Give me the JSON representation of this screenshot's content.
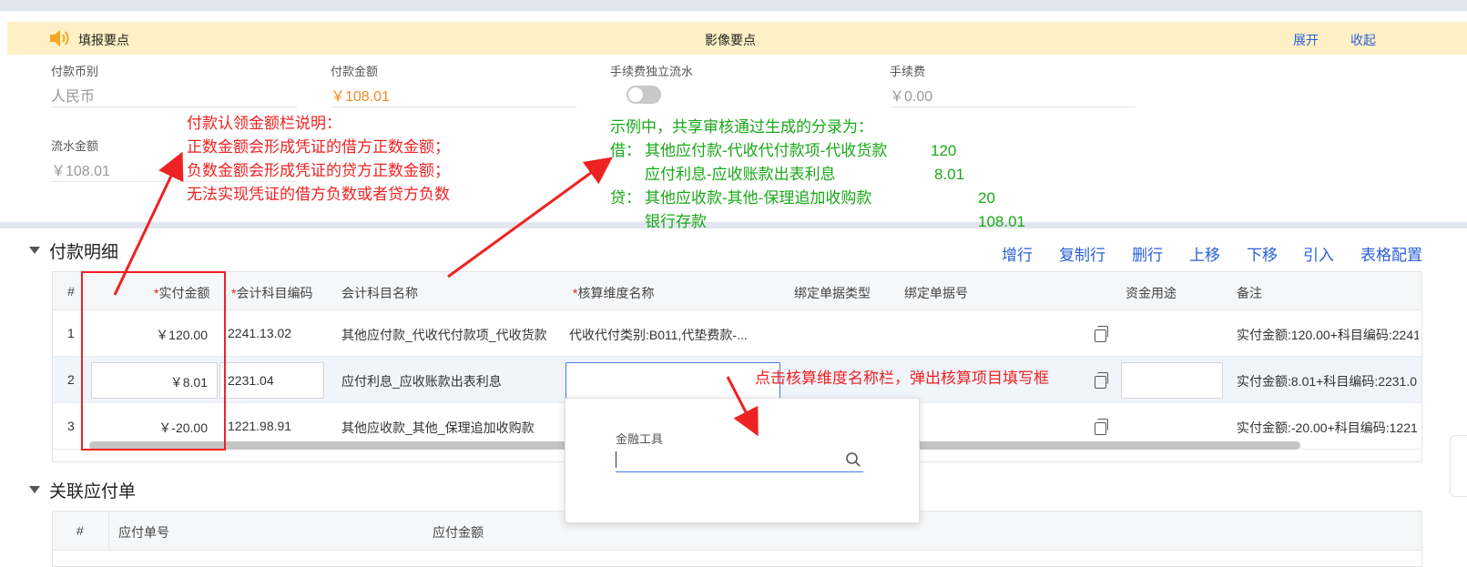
{
  "tip_bar": {
    "label_left": "填报要点",
    "label_center": "影像要点",
    "expand": "展开",
    "collapse": "收起"
  },
  "fields": {
    "currency_label": "付款币别",
    "currency_value": "人民币",
    "amount_label": "付款金额",
    "amount_value": "￥108.01",
    "fee_flow_label": "手续费独立流水",
    "fee_label": "手续费",
    "fee_value": "￥0.00",
    "flow_amount_label": "流水金额",
    "flow_amount_value": "￥108.01"
  },
  "annotations": {
    "red_note": [
      "付款认领金额栏说明：",
      "正数金额会形成凭证的借方正数金额；",
      "负数金额会形成凭证的贷方正数金额；",
      "无法实现凭证的借方负数或者贷方负数"
    ],
    "green_note": {
      "title": "示例中，共享审核通过生成的分录为：",
      "lines": [
        {
          "prefix": "借：",
          "text": "其他应付款-代收代付款项-代收货款",
          "amount": "120"
        },
        {
          "prefix": "",
          "text": "应付利息-应收账款出表利息",
          "amount": "8.01"
        },
        {
          "prefix": "贷：",
          "text": "其他应收款-其他-保理追加收购款",
          "amount": "20"
        },
        {
          "prefix": "",
          "text": "银行存款",
          "amount": "108.01"
        }
      ]
    },
    "popup_note": "点击核算维度名称栏，弹出核算项目填写框"
  },
  "payment_detail": {
    "title": "付款明细",
    "actions": [
      "增行",
      "复制行",
      "删行",
      "上移",
      "下移",
      "引入",
      "表格配置"
    ],
    "columns": {
      "no": "#",
      "actual_amount": "实付金额",
      "account_code": "会计科目编码",
      "account_name": "会计科目名称",
      "dimension": "核算维度名称",
      "bind_type": "绑定单据类型",
      "bind_no": "绑定单据号",
      "fund_use": "资金用途",
      "remark": "备注"
    },
    "rows": [
      {
        "no": "1",
        "amount": "￥120.00",
        "code": "2241.13.02",
        "name": "其他应付款_代收代付款项_代收货款",
        "dimension": "代收代付类别:B011,代垫费款-...",
        "remark": "实付金额:120.00+科目编码:2241"
      },
      {
        "no": "2",
        "amount": "￥8.01",
        "code": "2231.04",
        "name": "应付利息_应收账款出表利息",
        "dimension": "",
        "remark": "实付金额:8.01+科目编码:2231.0"
      },
      {
        "no": "3",
        "amount": "￥-20.00",
        "code": "1221.98.91",
        "name": "其他应收款_其他_保理追加收购款",
        "dimension": "",
        "remark": "实付金额:-20.00+科目编码:1221"
      }
    ]
  },
  "popup": {
    "field_label": "金融工具",
    "field_value": ""
  },
  "related_payable": {
    "title": "关联应付单",
    "columns": {
      "no": "#",
      "bill_no": "应付单号",
      "amount": "应付金额"
    }
  },
  "colors": {
    "accent": "#2b5fd9",
    "annotation_red": "#ee2222",
    "annotation_green": "#18a818",
    "tip_bar_bg": "#fdf0c4",
    "amount_orange": "#f08a24"
  }
}
